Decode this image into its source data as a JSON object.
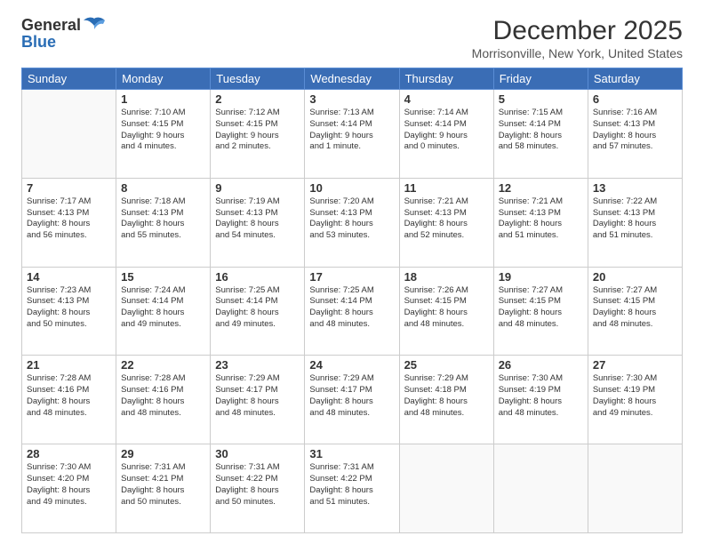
{
  "header": {
    "logo_general": "General",
    "logo_blue": "Blue",
    "month_title": "December 2025",
    "location": "Morrisonville, New York, United States"
  },
  "weekdays": [
    "Sunday",
    "Monday",
    "Tuesday",
    "Wednesday",
    "Thursday",
    "Friday",
    "Saturday"
  ],
  "weeks": [
    [
      {
        "day": "",
        "sunrise": "",
        "sunset": "",
        "daylight": ""
      },
      {
        "day": "1",
        "sunrise": "Sunrise: 7:10 AM",
        "sunset": "Sunset: 4:15 PM",
        "daylight": "Daylight: 9 hours and 4 minutes."
      },
      {
        "day": "2",
        "sunrise": "Sunrise: 7:12 AM",
        "sunset": "Sunset: 4:15 PM",
        "daylight": "Daylight: 9 hours and 2 minutes."
      },
      {
        "day": "3",
        "sunrise": "Sunrise: 7:13 AM",
        "sunset": "Sunset: 4:14 PM",
        "daylight": "Daylight: 9 hours and 1 minute."
      },
      {
        "day": "4",
        "sunrise": "Sunrise: 7:14 AM",
        "sunset": "Sunset: 4:14 PM",
        "daylight": "Daylight: 9 hours and 0 minutes."
      },
      {
        "day": "5",
        "sunrise": "Sunrise: 7:15 AM",
        "sunset": "Sunset: 4:14 PM",
        "daylight": "Daylight: 8 hours and 58 minutes."
      },
      {
        "day": "6",
        "sunrise": "Sunrise: 7:16 AM",
        "sunset": "Sunset: 4:13 PM",
        "daylight": "Daylight: 8 hours and 57 minutes."
      }
    ],
    [
      {
        "day": "7",
        "sunrise": "Sunrise: 7:17 AM",
        "sunset": "Sunset: 4:13 PM",
        "daylight": "Daylight: 8 hours and 56 minutes."
      },
      {
        "day": "8",
        "sunrise": "Sunrise: 7:18 AM",
        "sunset": "Sunset: 4:13 PM",
        "daylight": "Daylight: 8 hours and 55 minutes."
      },
      {
        "day": "9",
        "sunrise": "Sunrise: 7:19 AM",
        "sunset": "Sunset: 4:13 PM",
        "daylight": "Daylight: 8 hours and 54 minutes."
      },
      {
        "day": "10",
        "sunrise": "Sunrise: 7:20 AM",
        "sunset": "Sunset: 4:13 PM",
        "daylight": "Daylight: 8 hours and 53 minutes."
      },
      {
        "day": "11",
        "sunrise": "Sunrise: 7:21 AM",
        "sunset": "Sunset: 4:13 PM",
        "daylight": "Daylight: 8 hours and 52 minutes."
      },
      {
        "day": "12",
        "sunrise": "Sunrise: 7:21 AM",
        "sunset": "Sunset: 4:13 PM",
        "daylight": "Daylight: 8 hours and 51 minutes."
      },
      {
        "day": "13",
        "sunrise": "Sunrise: 7:22 AM",
        "sunset": "Sunset: 4:13 PM",
        "daylight": "Daylight: 8 hours and 51 minutes."
      }
    ],
    [
      {
        "day": "14",
        "sunrise": "Sunrise: 7:23 AM",
        "sunset": "Sunset: 4:13 PM",
        "daylight": "Daylight: 8 hours and 50 minutes."
      },
      {
        "day": "15",
        "sunrise": "Sunrise: 7:24 AM",
        "sunset": "Sunset: 4:14 PM",
        "daylight": "Daylight: 8 hours and 49 minutes."
      },
      {
        "day": "16",
        "sunrise": "Sunrise: 7:25 AM",
        "sunset": "Sunset: 4:14 PM",
        "daylight": "Daylight: 8 hours and 49 minutes."
      },
      {
        "day": "17",
        "sunrise": "Sunrise: 7:25 AM",
        "sunset": "Sunset: 4:14 PM",
        "daylight": "Daylight: 8 hours and 48 minutes."
      },
      {
        "day": "18",
        "sunrise": "Sunrise: 7:26 AM",
        "sunset": "Sunset: 4:15 PM",
        "daylight": "Daylight: 8 hours and 48 minutes."
      },
      {
        "day": "19",
        "sunrise": "Sunrise: 7:27 AM",
        "sunset": "Sunset: 4:15 PM",
        "daylight": "Daylight: 8 hours and 48 minutes."
      },
      {
        "day": "20",
        "sunrise": "Sunrise: 7:27 AM",
        "sunset": "Sunset: 4:15 PM",
        "daylight": "Daylight: 8 hours and 48 minutes."
      }
    ],
    [
      {
        "day": "21",
        "sunrise": "Sunrise: 7:28 AM",
        "sunset": "Sunset: 4:16 PM",
        "daylight": "Daylight: 8 hours and 48 minutes."
      },
      {
        "day": "22",
        "sunrise": "Sunrise: 7:28 AM",
        "sunset": "Sunset: 4:16 PM",
        "daylight": "Daylight: 8 hours and 48 minutes."
      },
      {
        "day": "23",
        "sunrise": "Sunrise: 7:29 AM",
        "sunset": "Sunset: 4:17 PM",
        "daylight": "Daylight: 8 hours and 48 minutes."
      },
      {
        "day": "24",
        "sunrise": "Sunrise: 7:29 AM",
        "sunset": "Sunset: 4:17 PM",
        "daylight": "Daylight: 8 hours and 48 minutes."
      },
      {
        "day": "25",
        "sunrise": "Sunrise: 7:29 AM",
        "sunset": "Sunset: 4:18 PM",
        "daylight": "Daylight: 8 hours and 48 minutes."
      },
      {
        "day": "26",
        "sunrise": "Sunrise: 7:30 AM",
        "sunset": "Sunset: 4:19 PM",
        "daylight": "Daylight: 8 hours and 48 minutes."
      },
      {
        "day": "27",
        "sunrise": "Sunrise: 7:30 AM",
        "sunset": "Sunset: 4:19 PM",
        "daylight": "Daylight: 8 hours and 49 minutes."
      }
    ],
    [
      {
        "day": "28",
        "sunrise": "Sunrise: 7:30 AM",
        "sunset": "Sunset: 4:20 PM",
        "daylight": "Daylight: 8 hours and 49 minutes."
      },
      {
        "day": "29",
        "sunrise": "Sunrise: 7:31 AM",
        "sunset": "Sunset: 4:21 PM",
        "daylight": "Daylight: 8 hours and 50 minutes."
      },
      {
        "day": "30",
        "sunrise": "Sunrise: 7:31 AM",
        "sunset": "Sunset: 4:22 PM",
        "daylight": "Daylight: 8 hours and 50 minutes."
      },
      {
        "day": "31",
        "sunrise": "Sunrise: 7:31 AM",
        "sunset": "Sunset: 4:22 PM",
        "daylight": "Daylight: 8 hours and 51 minutes."
      },
      {
        "day": "",
        "sunrise": "",
        "sunset": "",
        "daylight": ""
      },
      {
        "day": "",
        "sunrise": "",
        "sunset": "",
        "daylight": ""
      },
      {
        "day": "",
        "sunrise": "",
        "sunset": "",
        "daylight": ""
      }
    ]
  ]
}
